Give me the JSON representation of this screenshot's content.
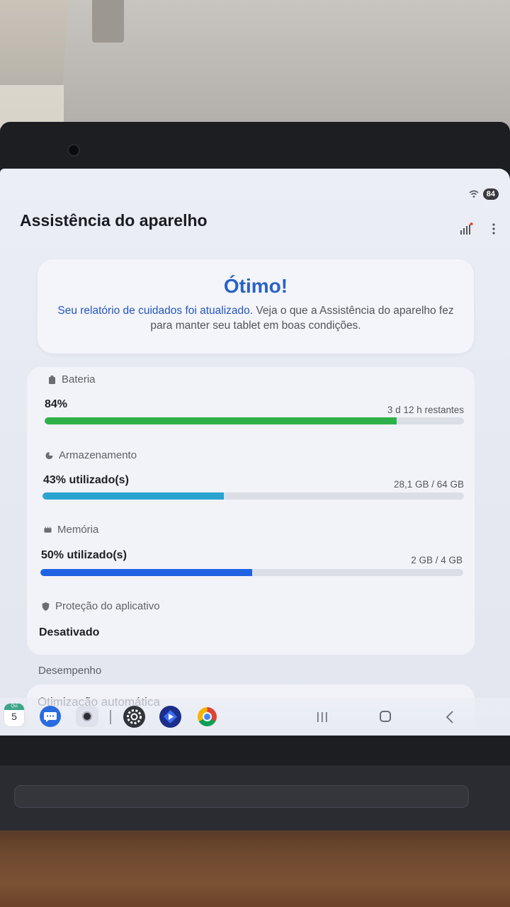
{
  "status_bar": {
    "battery": "84"
  },
  "header": {
    "title": "Assistência do aparelho"
  },
  "hero": {
    "title": "Ótimo!",
    "link_text": "Seu relatório de cuidados foi atualizado.",
    "text": " Veja o que a Assistência do aparelho fez para manter seu tablet em boas condições."
  },
  "status": {
    "battery": {
      "label": "Bateria",
      "value": "84%",
      "detail": "3 d 12 h restantes",
      "percent": 84,
      "color": "#2fb04a"
    },
    "storage": {
      "label": "Armazenamento",
      "value": "43% utilizado(s)",
      "detail": "28,1 GB / 64 GB",
      "percent": 43,
      "color": "#2aa3d0"
    },
    "memory": {
      "label": "Memória",
      "value": "50% utilizado(s)",
      "detail": "2 GB / 4 GB",
      "percent": 50,
      "color": "#1f63e3"
    },
    "protection": {
      "label": "Proteção do aplicativo",
      "value": "Desativado"
    }
  },
  "performance": {
    "section_label": "Desempenho",
    "item": "Otimização automática"
  },
  "taskbar": {
    "calendar_day": "5",
    "calendar_weekday": "Qui",
    "apps": [
      "calendar-icon",
      "messages-icon",
      "camera-icon",
      "settings-icon",
      "play-store-icon",
      "chrome-icon"
    ]
  }
}
